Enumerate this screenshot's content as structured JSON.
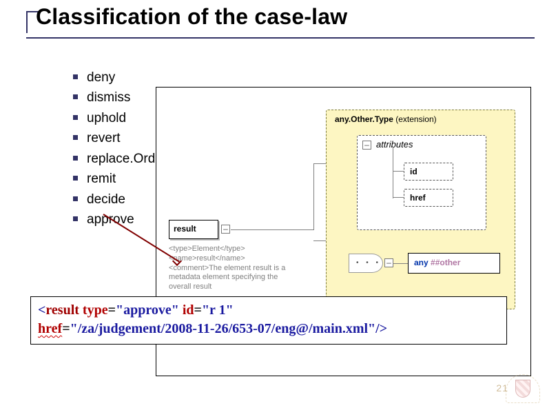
{
  "title": "Classification of the case-law",
  "bullets": [
    "deny",
    "dismiss",
    "uphold",
    "revert",
    "replace.Order",
    "remit",
    "decide",
    "approve"
  ],
  "diagram": {
    "result_label": "result",
    "extension_label_bold": "any.Other.Type",
    "extension_label_suffix": " (extension)",
    "attributes_label": "attributes",
    "attr_id": "id",
    "attr_href": "href",
    "any_keyword": "any",
    "any_namespace": "##other",
    "comment": "<type>Element</type>\n<name>result</name>\n<comment>The element result is a metadata element specifying the overall result"
  },
  "code": {
    "open": "<",
    "elem": "result",
    "a1": "type",
    "v1": "\"approve\"",
    "a2": "id",
    "v2": "\"r 1\"",
    "a3": "href",
    "v3": "\"/za/judgement/2008-11-26/653-07/eng@/main.xml\"",
    "close": "/>"
  },
  "page_number": "21"
}
